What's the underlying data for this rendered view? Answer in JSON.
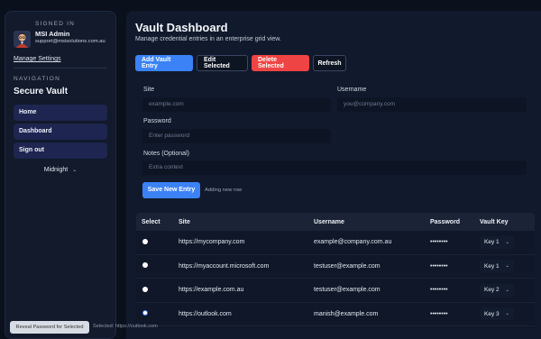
{
  "sidebar": {
    "signed_in_label": "SIGNED IN",
    "user_name": "MSI Admin",
    "user_email": "support@msisolutions.com.au",
    "manage_settings": "Manage Settings",
    "nav_label": "NAVIGATION",
    "brand": "Secure Vault",
    "nav_items": [
      {
        "label": "Home"
      },
      {
        "label": "Dashboard"
      },
      {
        "label": "Sign out"
      }
    ],
    "theme": "Midnight"
  },
  "main": {
    "title": "Vault Dashboard",
    "subtitle": "Manage credential entries in an enterprise grid view.",
    "buttons": {
      "add": "Add Vault Entry",
      "edit": "Edit Selected",
      "delete": "Delete Selected",
      "refresh": "Refresh"
    },
    "form": {
      "site_label": "Site",
      "site_placeholder": "example.com",
      "username_label": "Username",
      "username_placeholder": "you@company.com",
      "password_label": "Password",
      "password_placeholder": "Enter password",
      "notes_label": "Notes (Optional)",
      "notes_placeholder": "Extra context",
      "save_label": "Save New Entry",
      "hint": "Adding new row"
    },
    "table": {
      "headers": {
        "select": "Select",
        "site": "Site",
        "username": "Username",
        "password": "Password",
        "key": "Vault Key"
      },
      "rows": [
        {
          "site": "https://mycompany.com",
          "username": "example@company.com.au",
          "password": "••••••••",
          "key": "Key 1",
          "selected": false
        },
        {
          "site": "https://myaccount.microsoft.com",
          "username": "testuser@example.com",
          "password": "••••••••",
          "key": "Key 1",
          "selected": false
        },
        {
          "site": "https://example.com.au",
          "username": "testuser@example.com",
          "password": "••••••••",
          "key": "Key 2",
          "selected": false
        },
        {
          "site": "https://outlook.com",
          "username": "manish@example.com",
          "password": "••••••••",
          "key": "Key 3",
          "selected": true
        }
      ]
    },
    "reveal_label": "Reveal Password for Selected",
    "selection_info": "Selected: https://outlook.com"
  },
  "colors": {
    "accent": "#3b82f6",
    "danger": "#ef4444",
    "nav_item": "#1d2550"
  }
}
